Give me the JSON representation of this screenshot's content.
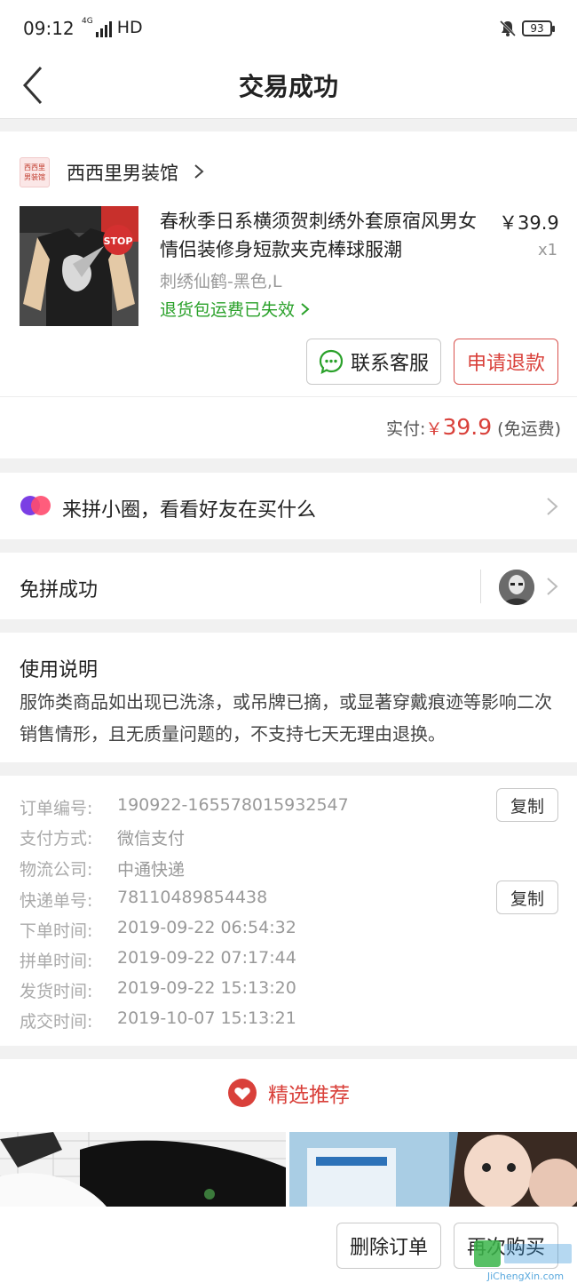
{
  "status_bar": {
    "time": "09:12",
    "network": "4G",
    "hd": "HD",
    "battery": "93"
  },
  "header": {
    "title": "交易成功"
  },
  "shop": {
    "logo_line1": "西西里",
    "logo_line2": "男装馆",
    "name": "西西里男装馆"
  },
  "product": {
    "title": "春秋季日系横须贺刺绣外套原宿风男女情侣装修身短款夹克棒球服潮",
    "price": "￥39.9",
    "qty": "x1",
    "sku": "刺绣仙鹤-黑色,L",
    "return_note": "退货包运费已失效",
    "image_sign": "STOP"
  },
  "actions": {
    "contact": "联系客服",
    "refund": "申请退款"
  },
  "payment": {
    "label": "实付:",
    "currency": "￥",
    "amount": "39.9",
    "shipping": "(免运费)"
  },
  "circle": {
    "text": "来拼小圈，看看好友在买什么"
  },
  "group": {
    "text": "免拼成功"
  },
  "usage": {
    "title": "使用说明",
    "text": "服饰类商品如出现已洗涤，或吊牌已摘，或显著穿戴痕迹等影响二次销售情形，且无质量问题的，不支持七天无理由退换。"
  },
  "order_info": {
    "rows": [
      {
        "label": "订单编号:",
        "value": "190922-165578015932547"
      },
      {
        "label": "支付方式:",
        "value": "微信支付"
      },
      {
        "label": "物流公司:",
        "value": "中通快递"
      },
      {
        "label": "快递单号:",
        "value": "78110489854438"
      },
      {
        "label": "下单时间:",
        "value": "2019-09-22 06:54:32"
      },
      {
        "label": "拼单时间:",
        "value": "2019-09-22 07:17:44"
      },
      {
        "label": "发货时间:",
        "value": "2019-09-22 15:13:20"
      },
      {
        "label": "成交时间:",
        "value": "2019-10-07 15:13:21"
      }
    ],
    "copy_label": "复制"
  },
  "recommend": {
    "title": "精选推荐"
  },
  "bottom": {
    "delete": "删除订单",
    "rebuy": "再次购买"
  },
  "watermark": {
    "text": "JiChengXin.com"
  },
  "colors": {
    "accent_red": "#d9403a",
    "green": "#2aa12a",
    "background": "#f1f1f1"
  }
}
